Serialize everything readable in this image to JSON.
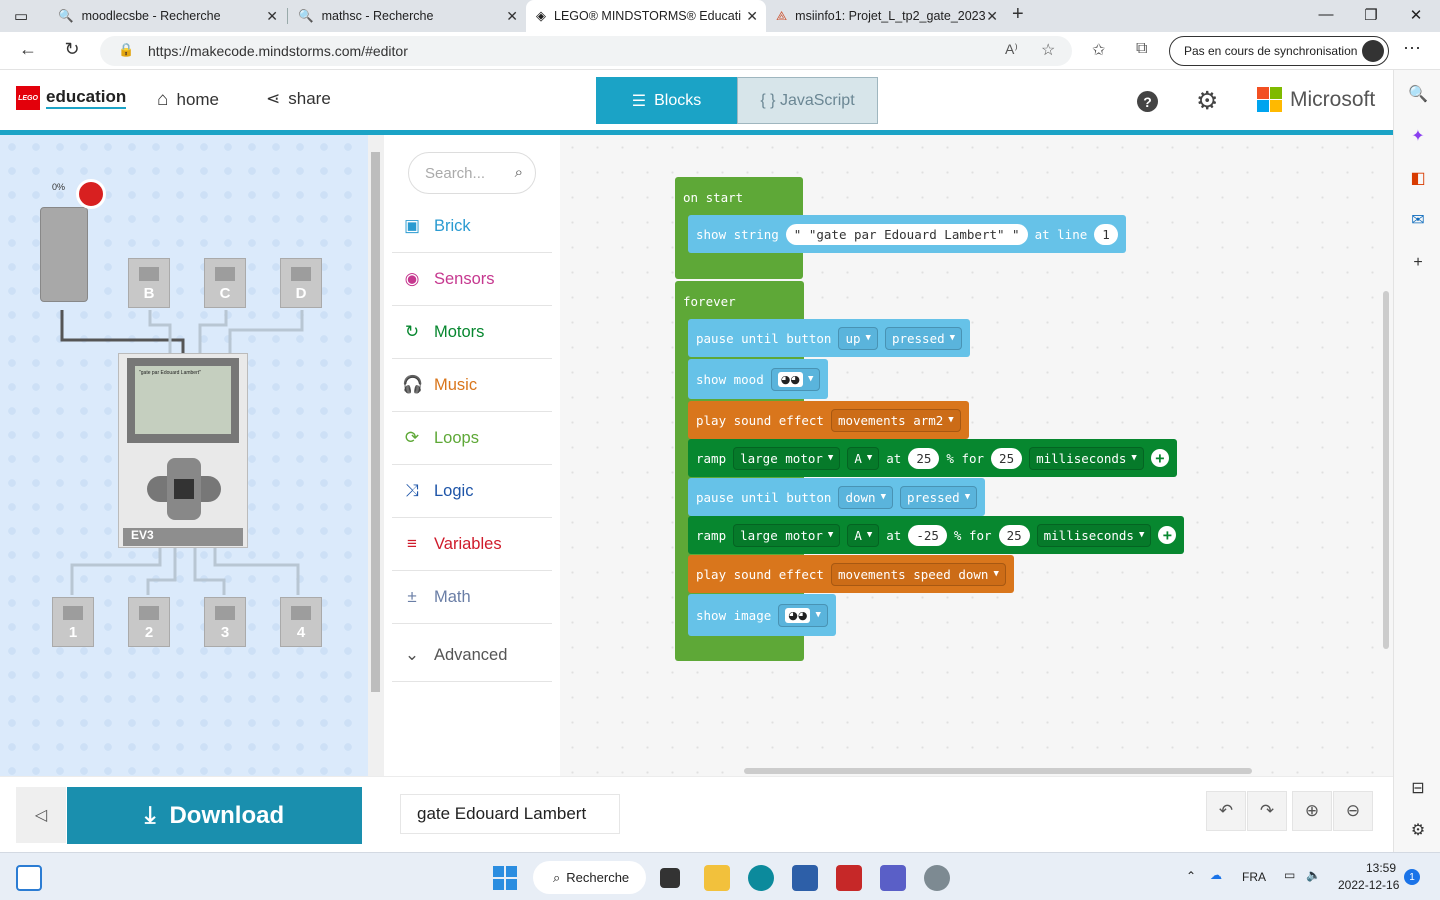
{
  "browser": {
    "tabs": [
      {
        "title": "moodlecsbe - Recherche",
        "icon": "search-icon"
      },
      {
        "title": "mathsc - Recherche",
        "icon": "search-icon"
      },
      {
        "title": "LEGO® MINDSTORMS® Educati",
        "icon": "lego-icon"
      },
      {
        "title": "msiinfo1: Projet_L_tp2_gate_2023",
        "icon": "moodle-icon"
      }
    ],
    "url": "https://makecode.mindstorms.com/#editor",
    "sync_label": "Pas en cours de synchronisation"
  },
  "app": {
    "logo_text": "education",
    "logo_brand": "LEGO",
    "home_label": "home",
    "share_label": "share",
    "blocks_label": "Blocks",
    "js_label": "{ } JavaScript",
    "help_symbol": "?",
    "microsoft_label": "Microsoft"
  },
  "simulator": {
    "motor_percent": "0%",
    "top_ports": [
      "B",
      "C",
      "D"
    ],
    "bottom_ports": [
      "1",
      "2",
      "3",
      "4"
    ],
    "screen_text": "\"gate par Edouard Lambert\"",
    "brick_label": "EV3"
  },
  "toolbox": {
    "search_placeholder": "Search...",
    "categories": [
      {
        "label": "Brick",
        "color": "#2b9bd1"
      },
      {
        "label": "Sensors",
        "color": "#c6388f"
      },
      {
        "label": "Motors",
        "color": "#07872f"
      },
      {
        "label": "Music",
        "color": "#d9761c"
      },
      {
        "label": "Loops",
        "color": "#5ea837"
      },
      {
        "label": "Logic",
        "color": "#1e55a8"
      },
      {
        "label": "Variables",
        "color": "#cf1b2b"
      },
      {
        "label": "Math",
        "color": "#6a7ea6"
      },
      {
        "label": "Advanced",
        "color": "#555555"
      }
    ]
  },
  "workspace": {
    "on_start": {
      "label": "on start",
      "show_string": "show string",
      "string_value": "\" \"gate par Edouard Lambert\" \"",
      "at_line": "at line",
      "line_value": "1"
    },
    "forever": {
      "label": "forever",
      "b1": {
        "text": "pause until button",
        "button": "up",
        "state": "pressed"
      },
      "b2": {
        "text": "show mood"
      },
      "b3": {
        "text": "play sound effect",
        "sound": "movements arm2"
      },
      "b4": {
        "ramp": "ramp",
        "motor": "large motor",
        "port": "A",
        "at": "at",
        "speed": "25",
        "pct_for": "% for",
        "duration": "25",
        "unit": "milliseconds"
      },
      "b5": {
        "text": "pause until button",
        "button": "down",
        "state": "pressed"
      },
      "b6": {
        "ramp": "ramp",
        "motor": "large motor",
        "port": "A",
        "at": "at",
        "speed": "-25",
        "pct_for": "% for",
        "duration": "25",
        "unit": "milliseconds"
      },
      "b7": {
        "text": "play sound effect",
        "sound": "movements speed down"
      },
      "b8": {
        "text": "show image"
      }
    }
  },
  "footer": {
    "download_label": "Download",
    "project_name": "gate Edouard Lambert"
  },
  "taskbar": {
    "search_label": "Recherche",
    "lang": "FRA",
    "time": "13:59",
    "date": "2022-12-16",
    "notif_count": "1"
  }
}
